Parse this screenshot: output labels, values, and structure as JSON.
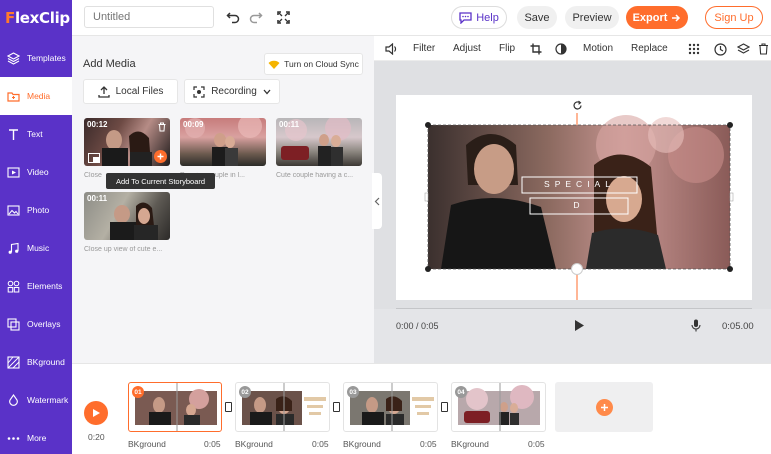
{
  "app": {
    "logo_text": "lexClip",
    "logo_initial": "F",
    "title_placeholder": "Untitled",
    "help_label": "Help",
    "save_label": "Save",
    "preview_label": "Preview",
    "export_label": "Export",
    "signup_label": "Sign Up",
    "accent": "#ff6d2c",
    "brand": "#5a32c8"
  },
  "sidebar": {
    "items": [
      {
        "label": "Templates",
        "icon": "layers-icon"
      },
      {
        "label": "Media",
        "icon": "folder-icon"
      },
      {
        "label": "Text",
        "icon": "text-icon"
      },
      {
        "label": "Video",
        "icon": "video-icon"
      },
      {
        "label": "Photo",
        "icon": "photo-icon"
      },
      {
        "label": "Music",
        "icon": "music-icon"
      },
      {
        "label": "Elements",
        "icon": "elements-icon"
      },
      {
        "label": "Overlays",
        "icon": "overlays-icon"
      },
      {
        "label": "BKground",
        "icon": "background-icon"
      },
      {
        "label": "Watermark",
        "icon": "watermark-icon"
      },
      {
        "label": "More",
        "icon": "more-icon"
      }
    ]
  },
  "media": {
    "title": "Add Media",
    "cloud_sync": "Turn on Cloud Sync",
    "local_files": "Local Files",
    "recording": "Recording",
    "tooltip": "Add To Current Storyboard",
    "thumbs": [
      {
        "duration": "00:12",
        "caption": "Close"
      },
      {
        "duration": "00:09",
        "caption": "Dancing couple in l..."
      },
      {
        "duration": "00:11",
        "caption": "Cute couple having a c..."
      },
      {
        "duration": "00:11",
        "caption": "Close up view of cute e..."
      }
    ]
  },
  "tools": {
    "filter": "Filter",
    "adjust": "Adjust",
    "flip": "Flip",
    "motion": "Motion",
    "replace": "Replace"
  },
  "stage": {
    "overlay_text_1": "SPECIAL",
    "overlay_text_2": "D",
    "time_current": "0:00 / 0:05",
    "time_total": "0:05.00"
  },
  "timeline": {
    "total_time": "0:20",
    "clips": [
      {
        "num": "01",
        "label": "BKground",
        "duration": "0:05"
      },
      {
        "num": "02",
        "label": "BKground",
        "duration": "0:05"
      },
      {
        "num": "03",
        "label": "BKground",
        "duration": "0:05"
      },
      {
        "num": "04",
        "label": "BKground",
        "duration": "0:05"
      }
    ]
  }
}
